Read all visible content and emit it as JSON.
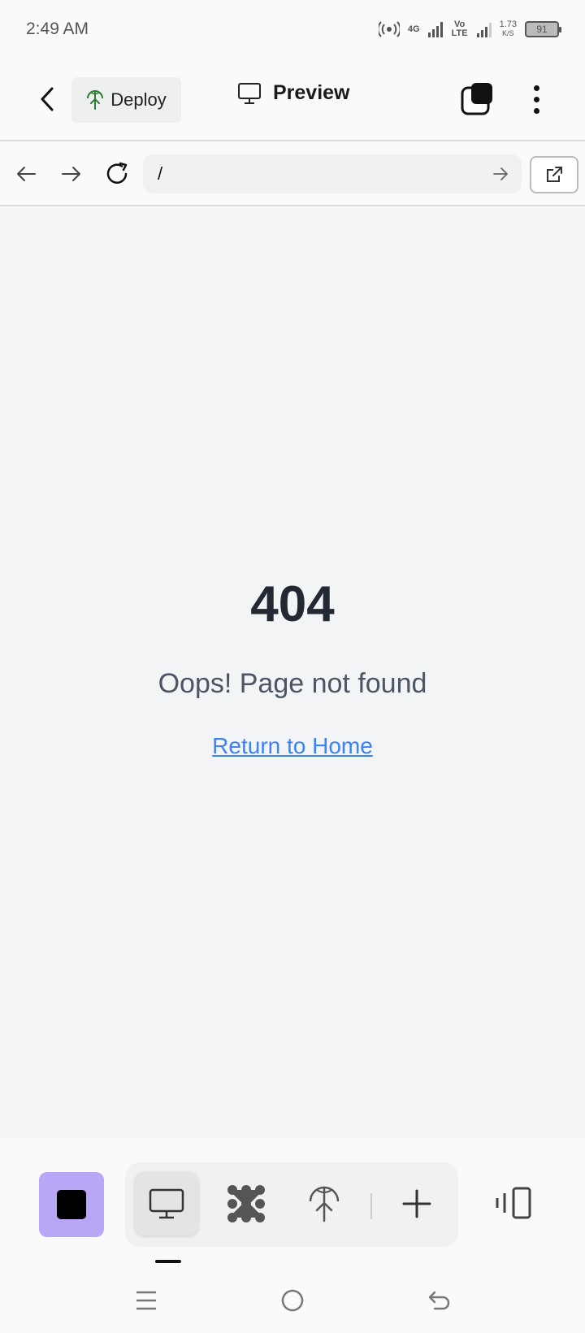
{
  "status_bar": {
    "time": "2:49 AM",
    "network_4g": "4G",
    "volte": "Vo LTE",
    "speed_value": "1.73",
    "speed_unit": "K/S",
    "battery": "91"
  },
  "header": {
    "deploy_label": "Deploy",
    "preview_label": "Preview"
  },
  "url_bar": {
    "value": "/"
  },
  "page": {
    "error_code": "404",
    "error_message": "Oops! Page not found",
    "return_link": "Return to Home"
  },
  "colors": {
    "accent_stop": "#b9a6f7",
    "link": "#3b82f6",
    "preview_bg": "#f3f4f6"
  }
}
